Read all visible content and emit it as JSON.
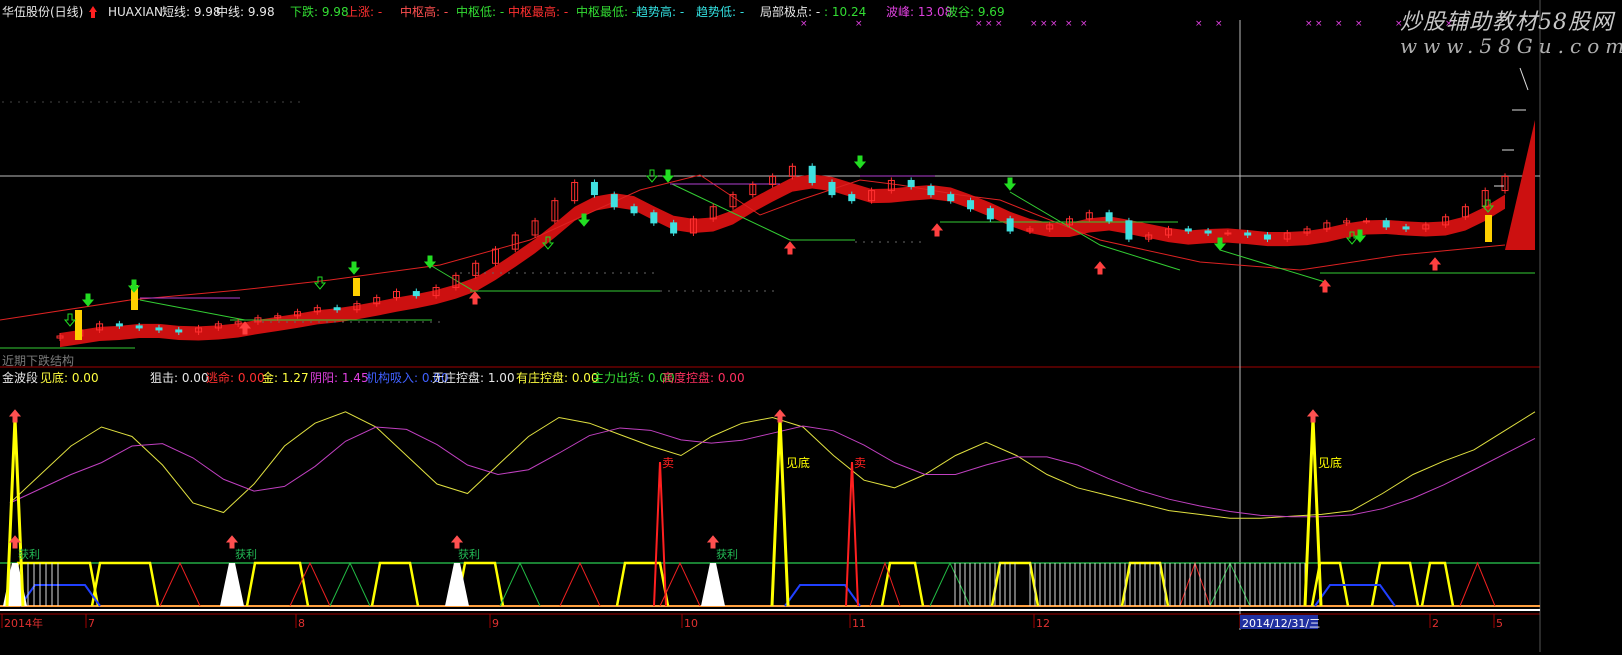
{
  "header": {
    "items": [
      {
        "text": "华伍股份(日线)",
        "color": "#e8e8e8"
      },
      {
        "text": "HUAXIAN",
        "color": "#e8e8e8"
      },
      {
        "text": "短线: 9.98",
        "color": "#e8e8e8"
      },
      {
        "text": "中线: 9.98",
        "color": "#e8e8e8"
      },
      {
        "text": "下跌: 9.98",
        "color": "#33dd33"
      },
      {
        "text": "上涨: -",
        "color": "#ff3030"
      },
      {
        "text": "中枢高: -",
        "color": "#ff5050"
      },
      {
        "text": "中枢低: -",
        "color": "#33dd33"
      },
      {
        "text": "中枢最高: -",
        "color": "#ff3030"
      },
      {
        "text": "中枢最低: -",
        "color": "#33dd33"
      },
      {
        "text": "趋势高: -",
        "color": "#33e0e0"
      },
      {
        "text": "趋势低: -",
        "color": "#33e0e0"
      },
      {
        "text": "局部极点: -",
        "color": "#e8e8e8"
      },
      {
        "text": ": 10.24",
        "color": "#33dd33"
      },
      {
        "text": "波峰: 13.08",
        "color": "#e040e0"
      },
      {
        "text": "波谷: 9.69",
        "color": "#33dd33"
      }
    ]
  },
  "watermark": {
    "title": "炒股辅助教材58股网",
    "url": "www.58Gu.com"
  },
  "left_label": "近期下跌结构",
  "sub_header": {
    "items": [
      {
        "text": "金波段",
        "color": "#e8e8e8"
      },
      {
        "text": "见底: 0.00",
        "color": "#ffff40"
      },
      {
        "text": "狙击: 0.00",
        "color": "#e8e8e8"
      },
      {
        "text": "逃命: 0.00",
        "color": "#ff3030"
      },
      {
        "text": "金: 1.27",
        "color": "#ffff40"
      },
      {
        "text": "阴阳: 1.45",
        "color": "#e040e0"
      },
      {
        "text": "机构吸入: 0.00",
        "color": "#4060ff"
      },
      {
        "text": "无庄控盘: 1.00",
        "color": "#e8e8e8"
      },
      {
        "text": "有庄控盘: 0.00",
        "color": "#ffff40"
      },
      {
        "text": "主力出货: 0.00",
        "color": "#33dd33"
      },
      {
        "text": "高度控盘: 0.00",
        "color": "#ff3060"
      }
    ]
  },
  "annotations": {
    "bottom_label": "见底",
    "sell_label": "卖",
    "profit_label": "获利"
  },
  "x_axis": {
    "labels": [
      "2014年",
      "7",
      "8",
      "9",
      "10",
      "11",
      "12",
      "2014/12/31/三",
      "2",
      "5"
    ],
    "highlight": "2014/12/31/三"
  },
  "colors": {
    "up_candle": "#ff3030",
    "down_candle": "#40e0e0",
    "band": "#cc1010",
    "ma_red": "#dd2222",
    "trend_green": "#33cc33",
    "k_line": "#e0e040",
    "d_line": "#c040c0",
    "signal_yellow": "#ffff00",
    "signal_red": "#ff2020",
    "axis_red": "#a00000"
  },
  "chart_data": {
    "type": "candlestick",
    "price_close": [
      4.6,
      4.9,
      5.2,
      5.1,
      5.0,
      4.9,
      4.8,
      5.0,
      5.2,
      5.3,
      5.5,
      5.6,
      5.8,
      6.0,
      5.9,
      6.2,
      6.5,
      6.8,
      6.6,
      7.0,
      7.6,
      8.2,
      8.9,
      9.6,
      10.3,
      11.3,
      12.2,
      11.6,
      11.0,
      10.7,
      10.2,
      9.7,
      10.4,
      11.0,
      11.6,
      12.1,
      12.5,
      13.0,
      12.2,
      11.6,
      11.3,
      11.8,
      12.3,
      12.0,
      11.6,
      11.3,
      10.9,
      10.4,
      9.8,
      9.9,
      10.1,
      10.4,
      10.7,
      10.3,
      9.4,
      9.6,
      9.9,
      9.8,
      9.7,
      9.7,
      9.6,
      9.4,
      9.7,
      9.9,
      10.2,
      10.3,
      10.3,
      10.0,
      9.9,
      10.1,
      10.5,
      11.0,
      11.8,
      12.5
    ],
    "oscillator_k": [
      30,
      45,
      60,
      70,
      65,
      50,
      30,
      25,
      40,
      60,
      72,
      78,
      70,
      55,
      40,
      35,
      50,
      65,
      75,
      72,
      66,
      60,
      55,
      65,
      72,
      75,
      70,
      55,
      42,
      38,
      45,
      55,
      62,
      55,
      45,
      38,
      34,
      30,
      26,
      24,
      22,
      22,
      23,
      24,
      26,
      35,
      45,
      52,
      58,
      68,
      78
    ]
  }
}
